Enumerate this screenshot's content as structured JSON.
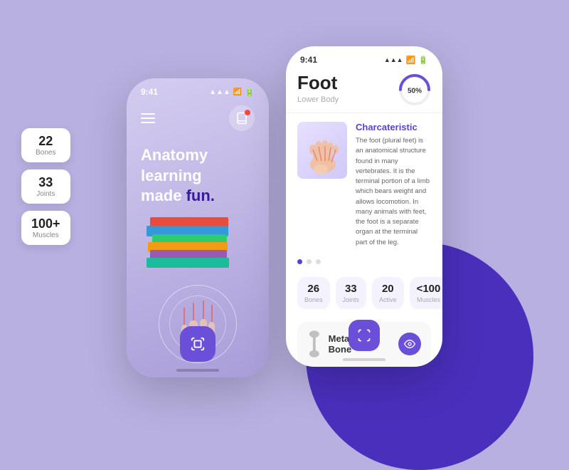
{
  "background": {
    "color": "#b8b0e0",
    "circle_color": "#4a2fbd"
  },
  "stats_left": [
    {
      "number": "22",
      "label": "Bones"
    },
    {
      "number": "33",
      "label": "Joints"
    },
    {
      "number": "100+",
      "label": "Muscles"
    }
  ],
  "left_phone": {
    "status_time": "9:41",
    "hero_text_line1": "Anatomy learning",
    "hero_text_line2": "made ",
    "hero_text_fun": "fun.",
    "scan_button_label": "scan"
  },
  "right_phone": {
    "status_time": "9:41",
    "title": "Foot",
    "subtitle": "Lower Body",
    "progress_percent": "50%",
    "characteristic": {
      "title": "Charcateristic",
      "description": "The foot (plural feet) is an anatomical structure found in many vertebrates. It is the terminal portion of a limb which bears weight and allows locomotion. In many animals with feet, the foot is a separate organ at the terminal part of the leg."
    },
    "stats": [
      {
        "number": "26",
        "label": "Bones"
      },
      {
        "number": "33",
        "label": "Joints"
      },
      {
        "number": "20",
        "label": "Active"
      },
      {
        "number": "<100",
        "label": "Muscles"
      }
    ],
    "bone": {
      "name": "Metatarsal Bone"
    },
    "dots": [
      true,
      false,
      false
    ]
  }
}
